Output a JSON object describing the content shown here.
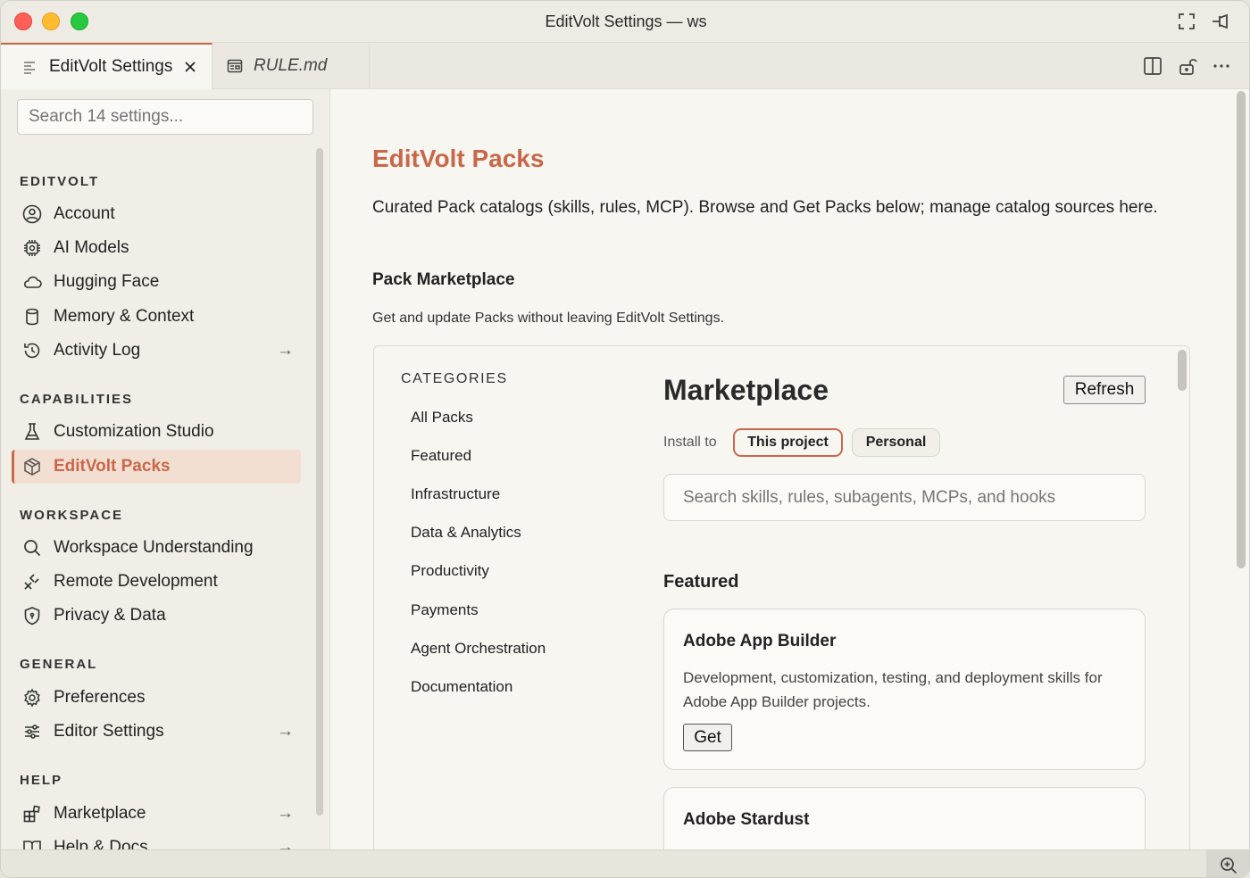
{
  "window": {
    "title": "EditVolt Settings — ws"
  },
  "tabs": [
    {
      "label": "EditVolt Settings",
      "icon": "settings-lines-icon"
    },
    {
      "label": "RULE.md",
      "icon": "preview-icon"
    }
  ],
  "sidebar": {
    "search_placeholder": "Search 14 settings...",
    "sections": {
      "editvolt": "EDITVOLT",
      "capabilities": "CAPABILITIES",
      "workspace": "WORKSPACE",
      "general": "GENERAL",
      "help": "HELP"
    },
    "items": {
      "account": "Account",
      "ai_models": "AI Models",
      "hugging_face": "Hugging Face",
      "memory": "Memory & Context",
      "activity_log": "Activity Log",
      "customization": "Customization Studio",
      "packs": "EditVolt Packs",
      "workspace_understanding": "Workspace Understanding",
      "remote_dev": "Remote Development",
      "privacy": "Privacy & Data",
      "preferences": "Preferences",
      "editor_settings": "Editor Settings",
      "marketplace": "Marketplace",
      "help_docs": "Help & Docs"
    },
    "arrow": "→"
  },
  "main": {
    "title": "EditVolt Packs",
    "description": "Curated Pack catalogs (skills, rules, MCP). Browse and Get Packs below; manage catalog sources here.",
    "subheading": "Pack Marketplace",
    "subdescription": "Get and update Packs without leaving EditVolt Settings.",
    "categories_heading": "CATEGORIES",
    "categories": [
      "All Packs",
      "Featured",
      "Infrastructure",
      "Data & Analytics",
      "Productivity",
      "Payments",
      "Agent Orchestration",
      "Documentation"
    ],
    "marketplace_title": "Marketplace",
    "refresh_label": "Refresh",
    "install_to_label": "Install to",
    "install_options": [
      "This project",
      "Personal"
    ],
    "install_selected": "This project",
    "search_placeholder": "Search skills, rules, subagents, MCPs, and hooks",
    "featured_heading": "Featured",
    "cards": [
      {
        "title": "Adobe App Builder",
        "description": "Development, customization, testing, and deployment skills for Adobe App Builder projects.",
        "button": "Get"
      },
      {
        "title": "Adobe Stardust"
      }
    ]
  },
  "colors": {
    "accent": "#c8684a",
    "active_bg": "#f2dfd2"
  }
}
